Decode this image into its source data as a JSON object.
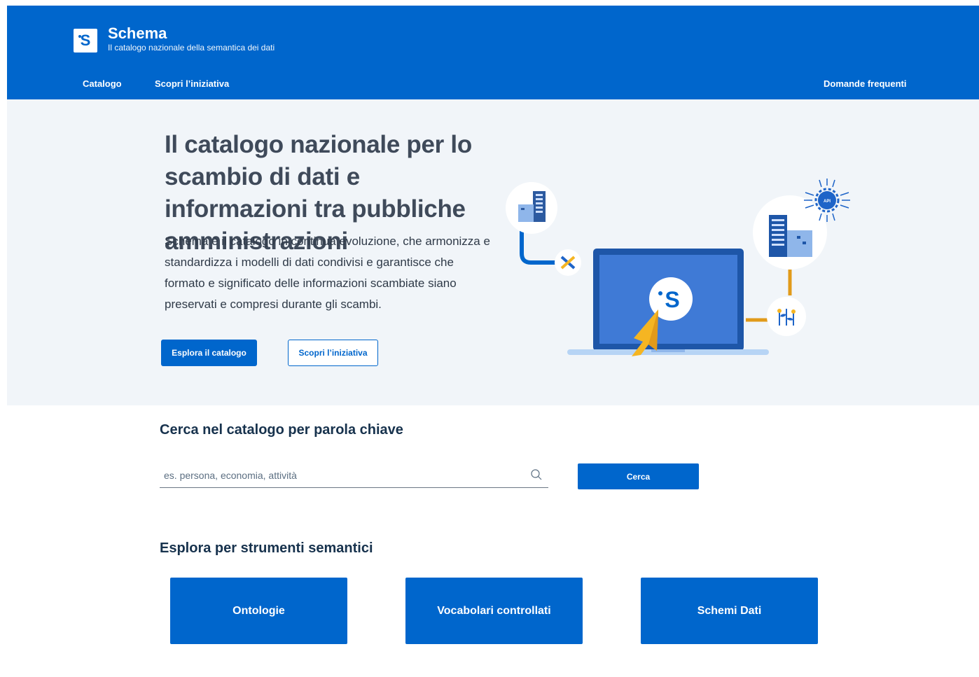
{
  "brand": {
    "logo_letter": "S",
    "title": "Schema",
    "subtitle": "Il catalogo nazionale della semantica dei dati"
  },
  "nav": {
    "items": [
      {
        "label": "Catalogo"
      },
      {
        "label": "Scopri l’iniziativa"
      }
    ],
    "faq_label": "Domande frequenti"
  },
  "hero": {
    "title": "Il catalogo nazionale per lo scambio di dati e informazioni tra pubbliche amministrazioni",
    "description": "Schema è il catalogo in continua evoluzione, che armonizza e standardizza i modelli di dati condivisi e garantisce che formato e significato delle informazioni scambiate siano preservati e compresi durante gli scambi.",
    "primary_button": "Esplora il catalogo",
    "secondary_button": "Scopri l’iniziativa",
    "illustration_logo": "S",
    "illustration_api": "API"
  },
  "search": {
    "title": "Cerca nel catalogo per parola chiave",
    "placeholder": "es. persona, economia, attività",
    "button": "Cerca"
  },
  "tools": {
    "title": "Esplora per strumenti semantici",
    "cards": [
      {
        "label": "Ontologie"
      },
      {
        "label": "Vocabolari controllati"
      },
      {
        "label": "Schemi Dati"
      }
    ]
  },
  "colors": {
    "primary": "#0066cc",
    "hero_bg": "#f1f5f9",
    "text_dark": "#17324d",
    "accent_yellow": "#f5b522"
  }
}
